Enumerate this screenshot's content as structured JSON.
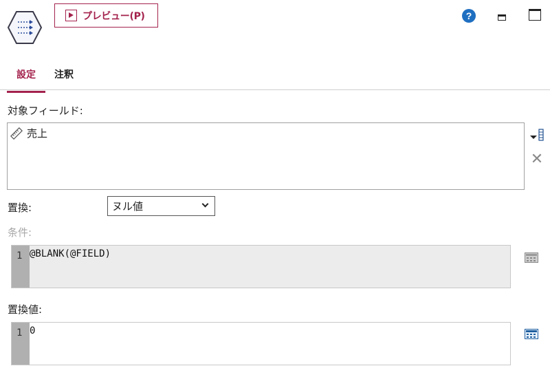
{
  "toolbar": {
    "preview_label": "プレビュー(P)"
  },
  "tabs": [
    {
      "label": "設定",
      "active": true
    },
    {
      "label": "注釈",
      "active": false
    }
  ],
  "target_fields": {
    "label": "対象フィールド:",
    "items": [
      {
        "name": "売上",
        "icon": "ruler-icon"
      }
    ]
  },
  "replace": {
    "label": "置換:",
    "selected": "ヌル値"
  },
  "condition": {
    "label": "条件:",
    "line_number": "1",
    "code": "@BLANK(@FIELD)",
    "disabled": true
  },
  "replace_value": {
    "label": "置換値:",
    "line_number": "1",
    "code": "0"
  },
  "colors": {
    "accent": "#a3224c",
    "help": "#1f6fc1"
  }
}
